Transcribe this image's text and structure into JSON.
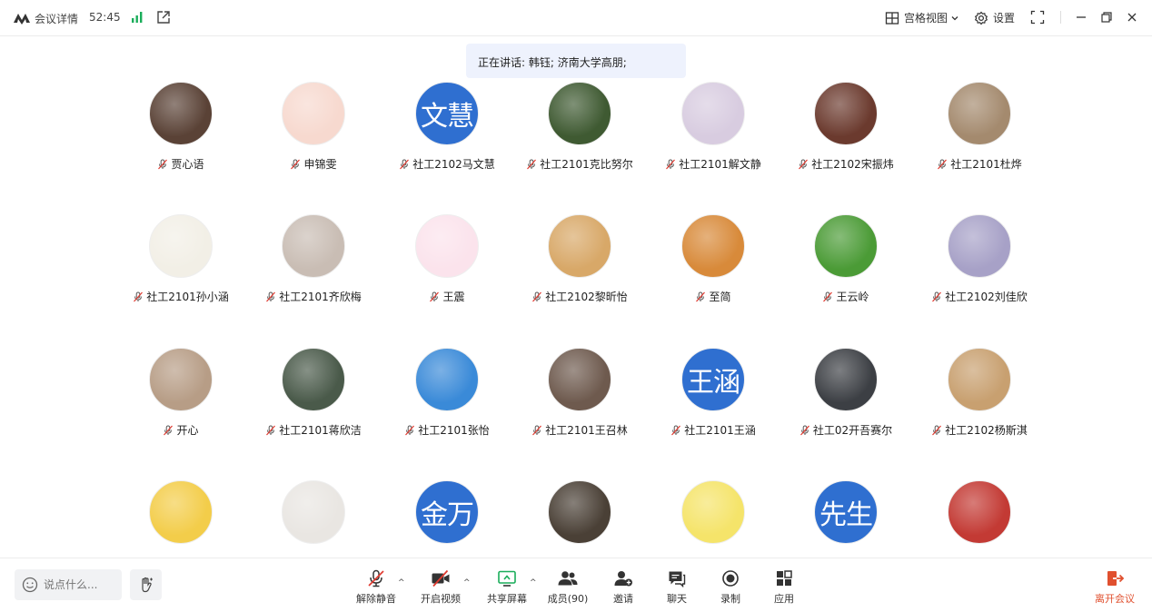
{
  "topbar": {
    "meeting_details": "会议详情",
    "timer": "52:45",
    "grid_view": "宫格视图",
    "settings": "设置"
  },
  "speaking": "正在讲话: 韩钰; 济南大学高朋;",
  "participants": [
    {
      "name": "贾心语",
      "avatar": "photo",
      "color": "#5a4236"
    },
    {
      "name": "申锦雯",
      "avatar": "photo",
      "color": "#f7d9cf"
    },
    {
      "name": "社工2102马文慧",
      "avatar": "text",
      "text": "文慧"
    },
    {
      "name": "社工2101克比努尔",
      "avatar": "photo",
      "color": "#3f5a32"
    },
    {
      "name": "社工2101解文静",
      "avatar": "photo",
      "color": "#d8cce0"
    },
    {
      "name": "社工2102宋振炜",
      "avatar": "photo",
      "color": "#6b3a2e"
    },
    {
      "name": "社工2101杜烨",
      "avatar": "photo",
      "color": "#a48a6e"
    },
    {
      "name": "社工2101孙小涵",
      "avatar": "photo",
      "color": "#f2efe6"
    },
    {
      "name": "社工2101齐欣梅",
      "avatar": "photo",
      "color": "#c9bdb4"
    },
    {
      "name": "王震",
      "avatar": "photo",
      "color": "#fbe3ec"
    },
    {
      "name": "社工2102黎昕怡",
      "avatar": "photo",
      "color": "#d8a868"
    },
    {
      "name": "至简",
      "avatar": "photo",
      "color": "#d88a3a"
    },
    {
      "name": "王云岭",
      "avatar": "photo",
      "color": "#4b9b36"
    },
    {
      "name": "社工2102刘佳欣",
      "avatar": "photo",
      "color": "#a7a1c7"
    },
    {
      "name": "开心",
      "avatar": "photo",
      "color": "#b79d86"
    },
    {
      "name": "社工2101蒋欣洁",
      "avatar": "photo",
      "color": "#4a5a4a"
    },
    {
      "name": "社工2101张怡",
      "avatar": "photo",
      "color": "#3a8ad8"
    },
    {
      "name": "社工2101王召林",
      "avatar": "photo",
      "color": "#6e5a4e"
    },
    {
      "name": "社工2101王涵",
      "avatar": "text",
      "text": "王涵"
    },
    {
      "name": "社工02开吾赛尔",
      "avatar": "photo",
      "color": "#3c3f44"
    },
    {
      "name": "社工2102杨斯淇",
      "avatar": "photo",
      "color": "#c8a070"
    },
    {
      "name": "",
      "avatar": "photo",
      "color": "#f3cd4a"
    },
    {
      "name": "",
      "avatar": "photo",
      "color": "#e9e6e2"
    },
    {
      "name": "",
      "avatar": "text",
      "text": "金万"
    },
    {
      "name": "",
      "avatar": "photo",
      "color": "#4a4036"
    },
    {
      "name": "",
      "avatar": "photo",
      "color": "#f5e46a"
    },
    {
      "name": "",
      "avatar": "text",
      "text": "先生"
    },
    {
      "name": "",
      "avatar": "photo",
      "color": "#c33a34"
    }
  ],
  "chat": {
    "placeholder": "说点什么..."
  },
  "toolbar": {
    "unmute": "解除静音",
    "start_video": "开启视频",
    "share_screen": "共享屏幕",
    "members": "成员(90)",
    "invite": "邀请",
    "chat": "聊天",
    "record": "录制",
    "apps": "应用",
    "leave": "离开会议"
  },
  "colors": {
    "accent": "#2f6fd0",
    "leave": "#e0502f",
    "signal": "#1aad5a",
    "speaking_bg": "#eef2fd"
  }
}
